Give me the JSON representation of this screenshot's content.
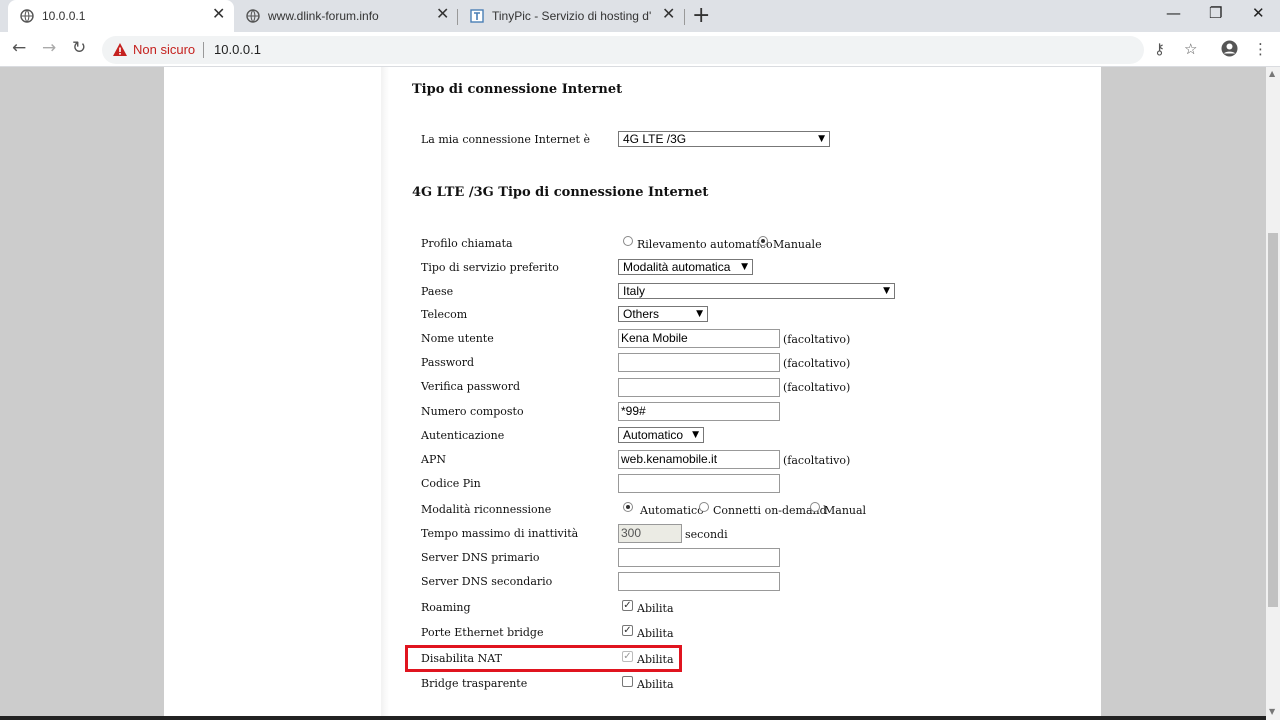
{
  "browser": {
    "tabs": [
      {
        "title": "10.0.0.1",
        "active": true,
        "icon": "globe-icon"
      },
      {
        "title": "www.dlink-forum.info",
        "active": false,
        "icon": "globe-icon"
      },
      {
        "title": "TinyPic - Servizio di hosting d'im",
        "active": false,
        "icon": "tinypic-icon"
      }
    ],
    "new_tab_symbol": "+",
    "security_label": "Non sicuro",
    "url": "10.0.0.1"
  },
  "page": {
    "heading_connection": "Tipo di connessione Internet",
    "my_connection_label": "La mia connessione Internet è",
    "my_connection_value": "4G LTE /3G",
    "heading_lte": "4G LTE /3G Tipo di connessione Internet",
    "fields": {
      "profilo": {
        "label": "Profilo chiamata",
        "options": [
          "Rilevamento automatico",
          "Manuale"
        ],
        "selected": "Manuale"
      },
      "servizio": {
        "label": "Tipo di servizio preferito",
        "value": "Modalità automatica"
      },
      "paese": {
        "label": "Paese",
        "value": "Italy"
      },
      "telecom": {
        "label": "Telecom",
        "value": "Others"
      },
      "nome_utente": {
        "label": "Nome utente",
        "value": "Kena Mobile",
        "note": "(facoltativo)"
      },
      "password": {
        "label": "Password",
        "value": "",
        "note": "(facoltativo)"
      },
      "verifica": {
        "label": "Verifica password",
        "value": "",
        "note": "(facoltativo)"
      },
      "numero": {
        "label": "Numero composto",
        "value": "*99#"
      },
      "autenticazione": {
        "label": "Autenticazione",
        "value": "Automatico"
      },
      "apn": {
        "label": "APN",
        "value": "web.kenamobile.it",
        "note": "(facoltativo)"
      },
      "pin": {
        "label": "Codice Pin",
        "value": ""
      },
      "riconnessione": {
        "label": "Modalità riconnessione",
        "options": [
          "Automatico",
          "Connetti on-demand",
          "Manual"
        ],
        "selected": "Automatico"
      },
      "inattivita": {
        "label": "Tempo massimo di inattività",
        "value": "300",
        "unit": "secondi"
      },
      "dns1": {
        "label": "Server DNS primario",
        "value": ""
      },
      "dns2": {
        "label": "Server DNS secondario",
        "value": ""
      },
      "roaming": {
        "label": "Roaming",
        "check_label": "Abilita",
        "checked": true
      },
      "bridge_eth": {
        "label": "Porte Ethernet bridge",
        "check_label": "Abilita",
        "checked": true
      },
      "nat": {
        "label": "Disabilita NAT",
        "check_label": "Abilita",
        "checked": true,
        "disabled": true
      },
      "bridge_tr": {
        "label": "Bridge trasparente",
        "check_label": "Abilita",
        "checked": false
      }
    }
  },
  "colors": {
    "highlight": "#e0141f",
    "warning": "#c5221f"
  }
}
